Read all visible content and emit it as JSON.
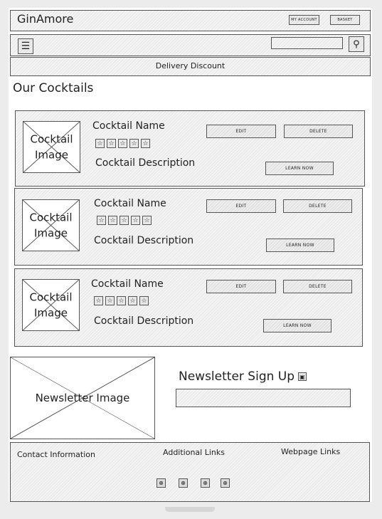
{
  "header": {
    "title": "GinAmore",
    "my_account": "My Account",
    "basket": "Basket"
  },
  "nav": {
    "menu_icon": "hamburger-icon",
    "search_placeholder": "",
    "search_icon": "magnifier-icon"
  },
  "banner": {
    "text": "Delivery Discount"
  },
  "section_title": "Our Cocktails",
  "cocktails": [
    {
      "image_label": "Cocktail Image",
      "name": "Cocktail Name",
      "rating_stars": 5,
      "description": "Cocktail Description",
      "edit": "Edit",
      "delete": "Delete",
      "learn": "Learn Now"
    },
    {
      "image_label": "Cocktail Image",
      "name": "Cocktail Name",
      "rating_stars": 5,
      "description": "Cocktail Description",
      "edit": "Edit",
      "delete": "Delete",
      "learn": "Learn Now"
    },
    {
      "image_label": "Cocktail Image",
      "name": "Cocktail Name",
      "rating_stars": 5,
      "description": "Cocktail Description",
      "edit": "Edit",
      "delete": "Delete",
      "learn": "Learn Now"
    }
  ],
  "newsletter": {
    "image_label": "Newsletter Image",
    "title": "Newsletter Sign Up",
    "icon": "checkbox-icon",
    "input_value": ""
  },
  "footer": {
    "contact": "Contact Information",
    "additional": "Additional Links",
    "webpage": "Webpage Links",
    "social_icons": [
      "social-icon-1",
      "social-icon-2",
      "social-icon-3",
      "social-icon-4"
    ]
  }
}
